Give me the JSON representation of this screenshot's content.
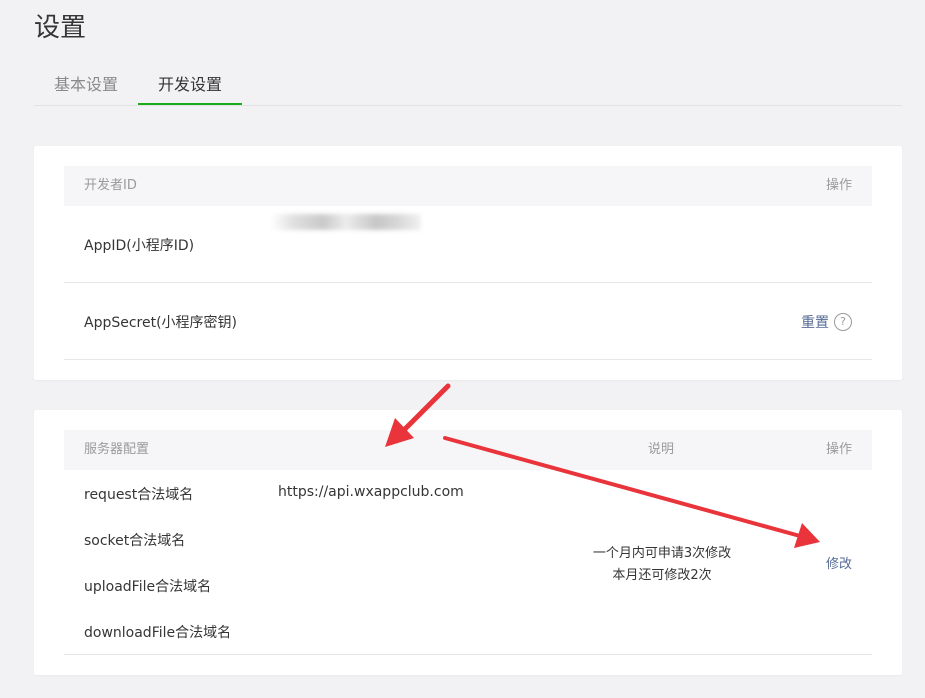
{
  "page": {
    "title": "设置"
  },
  "tabs": [
    {
      "label": "基本设置",
      "active": false
    },
    {
      "label": "开发设置",
      "active": true
    }
  ],
  "developer_id": {
    "header": {
      "col1": "开发者ID",
      "col_action": "操作"
    },
    "rows": [
      {
        "label": "AppID(小程序ID)",
        "value_obscured": true
      },
      {
        "label": "AppSecret(小程序密钥)",
        "action": "重置",
        "help_icon": "question-circle-icon"
      }
    ]
  },
  "server_config": {
    "header": {
      "col1": "服务器配置",
      "col_note": "说明",
      "col_action": "操作"
    },
    "rows": [
      {
        "label": "request合法域名",
        "value": "https://api.wxappclub.com"
      },
      {
        "label": "socket合法域名",
        "value": ""
      },
      {
        "label": "uploadFile合法域名",
        "value": ""
      },
      {
        "label": "downloadFile合法域名",
        "value": ""
      }
    ],
    "note_line1": "一个月内可申请3次修改",
    "note_line2": "本月还可修改2次",
    "action": "修改"
  },
  "colors": {
    "accent_green": "#1aad19",
    "link_blue": "#576b95",
    "annotation_red": "#e8343a"
  }
}
